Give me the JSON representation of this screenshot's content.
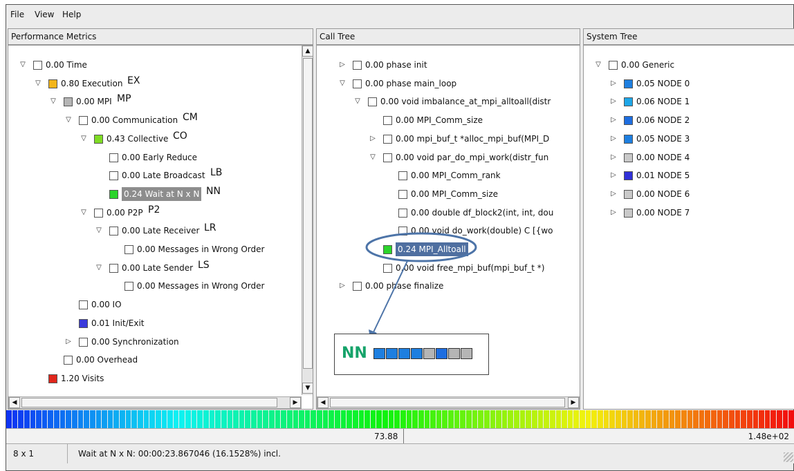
{
  "menu": {
    "file": "File",
    "view": "View",
    "help": "Help"
  },
  "panes": {
    "metrics": {
      "title": "Performance Metrics"
    },
    "calltree": {
      "title": "Call Tree"
    },
    "system": {
      "title": "System Tree"
    }
  },
  "metrics_tree": [
    {
      "label": "0.00 Time",
      "color": "#ffffff",
      "expander": "open",
      "tag": ""
    },
    {
      "label": "0.80 Execution",
      "color": "#f3b51a",
      "expander": "open",
      "tag": "EX"
    },
    {
      "label": "0.00 MPI",
      "color": "#b5b5b5",
      "expander": "open",
      "tag": "MP"
    },
    {
      "label": "0.00 Communication",
      "color": "#ffffff",
      "expander": "open",
      "tag": "CM"
    },
    {
      "label": "0.43 Collective",
      "color": "#7fdc24",
      "expander": "open",
      "tag": "CO"
    },
    {
      "label": "0.00 Early Reduce",
      "color": "#ffffff",
      "expander": "none",
      "tag": ""
    },
    {
      "label": "0.00 Late Broadcast",
      "color": "#ffffff",
      "expander": "none",
      "tag": "LB"
    },
    {
      "label": "0.24 Wait at N x N",
      "color": "#2bd42b",
      "expander": "none",
      "tag": "NN",
      "selected": true
    },
    {
      "label": "0.00 P2P",
      "color": "#ffffff",
      "expander": "open",
      "tag": "P2"
    },
    {
      "label": "0.00 Late Receiver",
      "color": "#ffffff",
      "expander": "open",
      "tag": "LR"
    },
    {
      "label": "0.00 Messages in Wrong Order",
      "color": "#ffffff",
      "expander": "none",
      "tag": ""
    },
    {
      "label": "0.00 Late Sender",
      "color": "#ffffff",
      "expander": "open",
      "tag": "LS"
    },
    {
      "label": "0.00 Messages in Wrong Order",
      "color": "#ffffff",
      "expander": "none",
      "tag": ""
    },
    {
      "label": "0.00 IO",
      "color": "#ffffff",
      "expander": "none",
      "tag": ""
    },
    {
      "label": "0.01 Init/Exit",
      "color": "#3b3bdc",
      "expander": "none",
      "tag": ""
    },
    {
      "label": "0.00 Synchronization",
      "color": "#ffffff",
      "expander": "closed",
      "tag": ""
    },
    {
      "label": "0.00 Overhead",
      "color": "#ffffff",
      "expander": "none",
      "tag": ""
    },
    {
      "label": "1.20 Visits",
      "color": "#e0261c",
      "expander": "none",
      "tag": ""
    }
  ],
  "call_tree": [
    {
      "label": "0.00 phase init",
      "color": "#ffffff",
      "expander": "closed"
    },
    {
      "label": "0.00 phase main_loop",
      "color": "#ffffff",
      "expander": "open"
    },
    {
      "label": "0.00 void imbalance_at_mpi_alltoall(distr",
      "color": "#ffffff",
      "expander": "open"
    },
    {
      "label": "0.00 MPI_Comm_size",
      "color": "#ffffff",
      "expander": "none"
    },
    {
      "label": "0.00 mpi_buf_t *alloc_mpi_buf(MPI_D",
      "color": "#ffffff",
      "expander": "closed"
    },
    {
      "label": "0.00 void par_do_mpi_work(distr_fun",
      "color": "#ffffff",
      "expander": "open"
    },
    {
      "label": "0.00 MPI_Comm_rank",
      "color": "#ffffff",
      "expander": "none"
    },
    {
      "label": "0.00 MPI_Comm_size",
      "color": "#ffffff",
      "expander": "none"
    },
    {
      "label": "0.00 double df_block2(int, int, dou",
      "color": "#ffffff",
      "expander": "none"
    },
    {
      "label": "0.00 void do_work(double) C [{wo",
      "color": "#ffffff",
      "expander": "none"
    },
    {
      "label": "0.24 MPI_Alltoall",
      "color": "#2bd42b",
      "expander": "none",
      "selected": true
    },
    {
      "label": "0.00 void free_mpi_buf(mpi_buf_t *)",
      "color": "#ffffff",
      "expander": "none"
    },
    {
      "label": "0.00 phase finalize",
      "color": "#ffffff",
      "expander": "closed"
    }
  ],
  "system_tree": [
    {
      "label": "0.00 Generic",
      "color": "#ffffff",
      "expander": "open"
    },
    {
      "label": "0.05 NODE 0",
      "color": "#1e7fe0",
      "expander": "closed"
    },
    {
      "label": "0.06 NODE 1",
      "color": "#1ea6e8",
      "expander": "closed"
    },
    {
      "label": "0.06 NODE 2",
      "color": "#1e6ee0",
      "expander": "closed"
    },
    {
      "label": "0.05 NODE 3",
      "color": "#1e7fe0",
      "expander": "closed"
    },
    {
      "label": "0.00 NODE 4",
      "color": "#c9c9c9",
      "expander": "closed"
    },
    {
      "label": "0.01 NODE 5",
      "color": "#3030d8",
      "expander": "closed"
    },
    {
      "label": "0.00 NODE 6",
      "color": "#c9c9c9",
      "expander": "closed"
    },
    {
      "label": "0.00 NODE 7",
      "color": "#c9c9c9",
      "expander": "closed"
    }
  ],
  "nn_inset": {
    "label": "NN",
    "label_color": "#16a36a",
    "cells": [
      "#1e7fe0",
      "#1e7fe0",
      "#1e7fe0",
      "#1e7fe0",
      "#b5b5b5",
      "#1e6ee0",
      "#b5b5b5",
      "#b5b5b5"
    ]
  },
  "scale": {
    "mid_value": "73.88",
    "max_value": "1.48e+02"
  },
  "status": {
    "dims": "8 x 1",
    "message": "Wait at N x N:  00:00:23.867046 (16.1528%)  incl."
  }
}
